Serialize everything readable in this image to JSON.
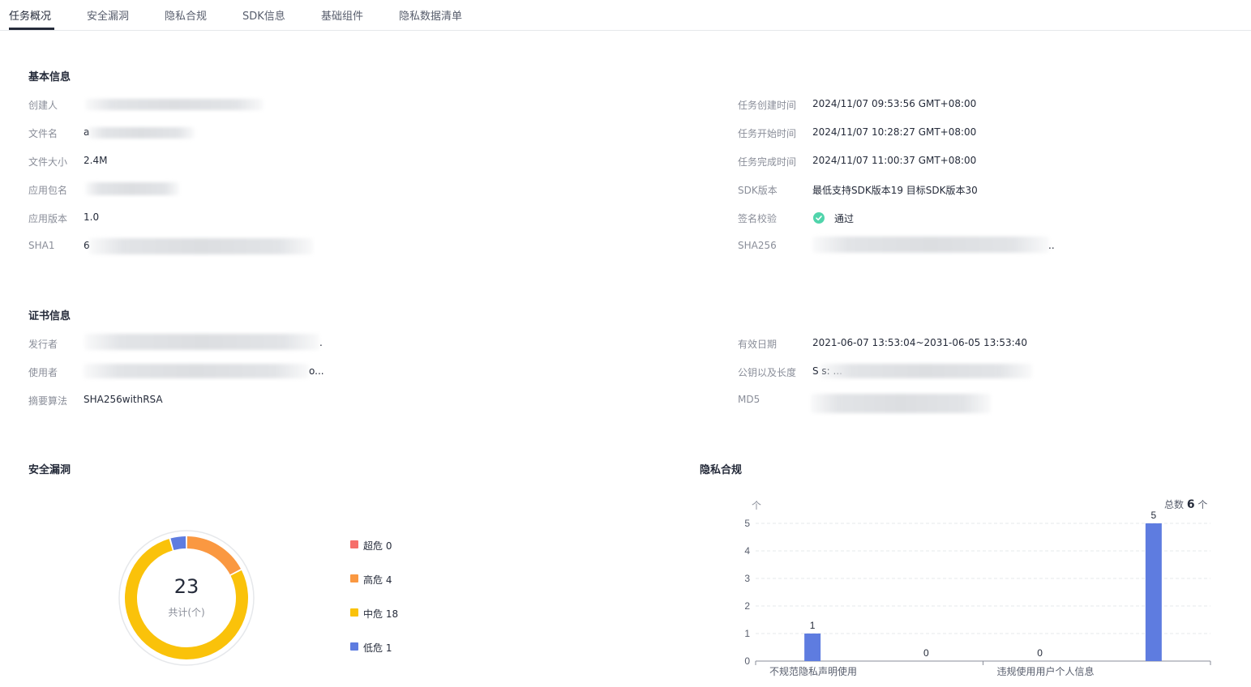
{
  "tabs": [
    {
      "label": "任务概况",
      "active": true
    },
    {
      "label": "安全漏洞",
      "active": false
    },
    {
      "label": "隐私合规",
      "active": false
    },
    {
      "label": "SDK信息",
      "active": false
    },
    {
      "label": "基础组件",
      "active": false
    },
    {
      "label": "隐私数据清单",
      "active": false
    }
  ],
  "basic_info": {
    "title": "基本信息",
    "left": [
      {
        "label": "创建人",
        "value": ""
      },
      {
        "label": "文件名",
        "value": "a"
      },
      {
        "label": "文件大小",
        "value": "2.4M"
      },
      {
        "label": "应用包名",
        "value": ""
      },
      {
        "label": "应用版本",
        "value": "1.0"
      },
      {
        "label": "SHA1",
        "value": "6"
      }
    ],
    "right": [
      {
        "label": "任务创建时间",
        "value": "2024/11/07 09:53:56 GMT+08:00"
      },
      {
        "label": "任务开始时间",
        "value": "2024/11/07 10:28:27 GMT+08:00"
      },
      {
        "label": "任务完成时间",
        "value": "2024/11/07 11:00:37 GMT+08:00"
      },
      {
        "label": "SDK版本",
        "value": "最低支持SDK版本19 目标SDK版本30"
      },
      {
        "label": "签名校验",
        "value": "通过"
      },
      {
        "label": "SHA256",
        "value": ".."
      }
    ]
  },
  "cert_info": {
    "title": "证书信息",
    "left": [
      {
        "label": "发行者",
        "value": "."
      },
      {
        "label": "使用者",
        "value": "o..."
      },
      {
        "label": "摘要算法",
        "value": "SHA256withRSA"
      }
    ],
    "right": [
      {
        "label": "有效日期",
        "value": "2021-06-07 13:53:04~2031-06-05 13:53:40"
      },
      {
        "label": "公钥以及长度",
        "value": "S                                            s: ..."
      },
      {
        "label": "MD5",
        "value": ""
      }
    ]
  },
  "vuln": {
    "title": "安全漏洞",
    "total": "23",
    "total_label": "共计(个)",
    "legend": [
      {
        "label": "超危 0",
        "count": 0,
        "color": "#f66f6a"
      },
      {
        "label": "高危 4",
        "count": 4,
        "color": "#fa9841"
      },
      {
        "label": "中危 18",
        "count": 18,
        "color": "#fac20a"
      },
      {
        "label": "低危 1",
        "count": 1,
        "color": "#5e7ce0"
      }
    ]
  },
  "privacy": {
    "title": "隐私合规",
    "unit_label": "个",
    "total_prefix": "总数",
    "total_value": "6",
    "total_suffix": "个"
  },
  "chart_data": {
    "type": "bar",
    "categories": [
      "不规范隐私声明使用",
      "",
      "违规使用用户个人信息",
      ""
    ],
    "values": [
      1,
      0,
      0,
      5
    ],
    "ylim": [
      0,
      5
    ],
    "yticks": [
      "0",
      "1",
      "2",
      "3",
      "4",
      "5"
    ],
    "grid": true,
    "bar_color": "#5e7ce0"
  }
}
